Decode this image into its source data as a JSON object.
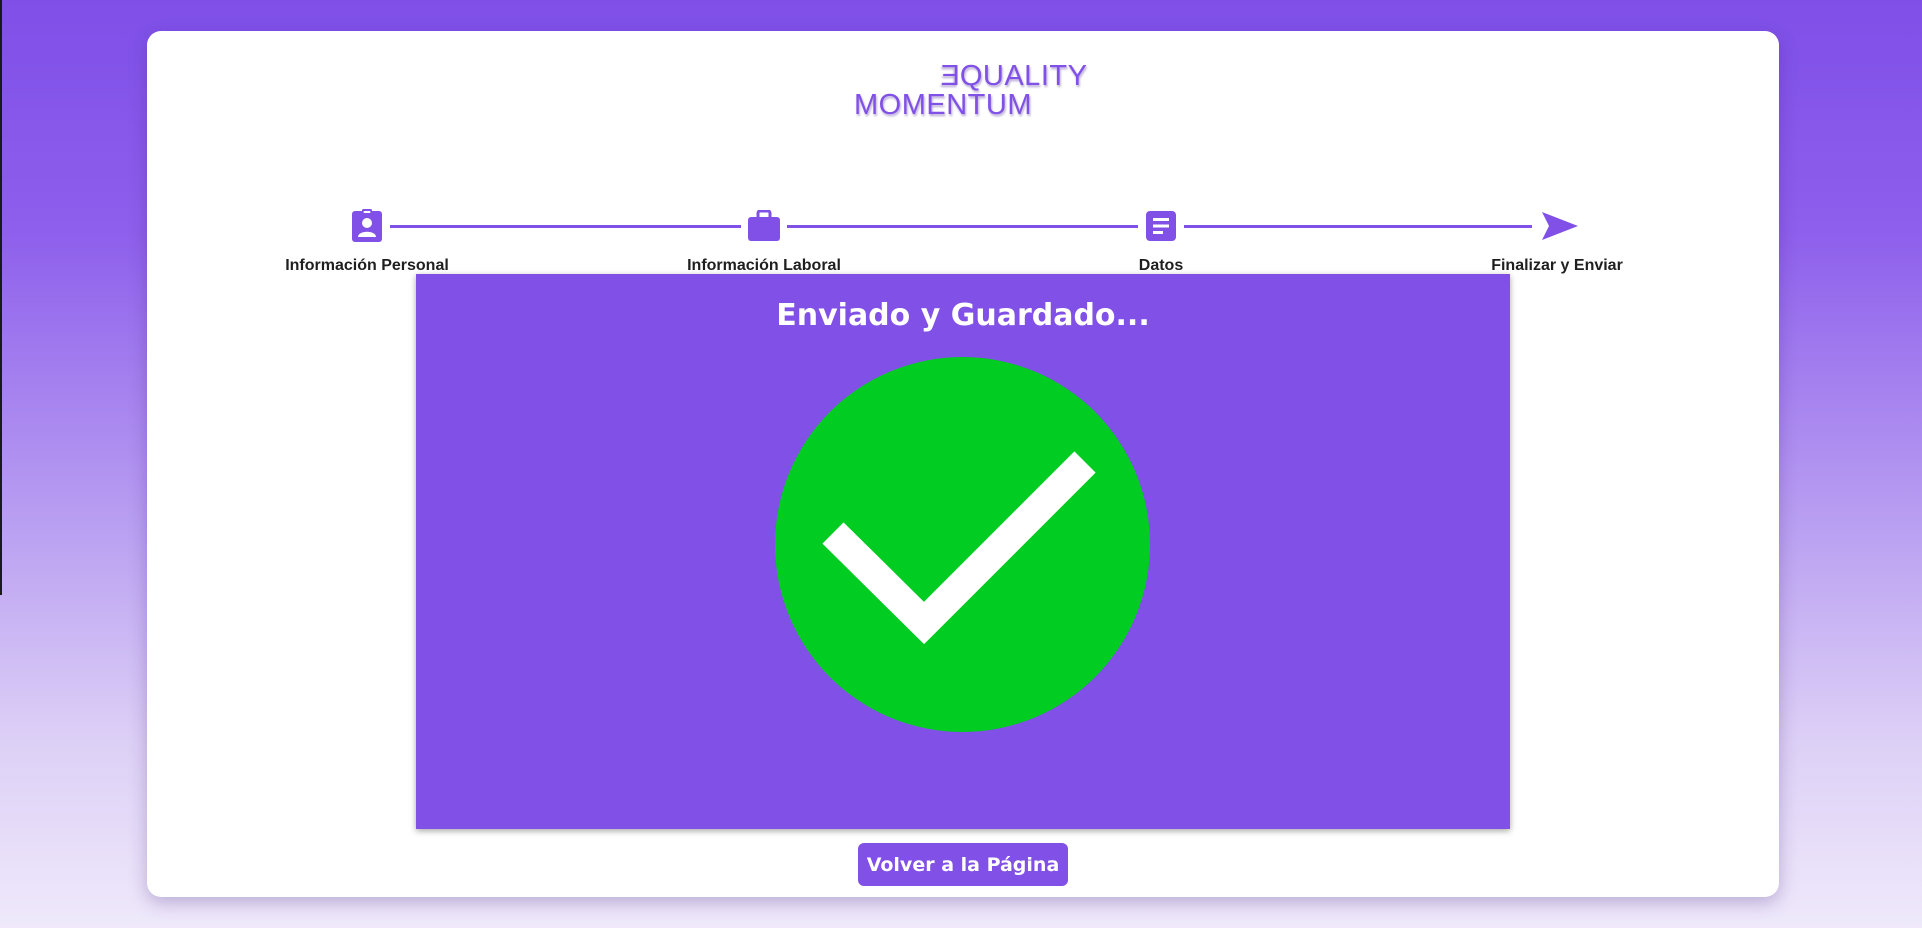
{
  "logo": {
    "line1_mirrored_letter": "E",
    "line1_rest": "QUALITY",
    "line2": "MOMENTUM"
  },
  "colors": {
    "accent": "#8150e6",
    "success": "#00cc22",
    "card": "#ffffff"
  },
  "stepper": {
    "steps": [
      {
        "label": "Información Personal",
        "icon": "id-badge-icon"
      },
      {
        "label": "Información Laboral",
        "icon": "briefcase-icon"
      },
      {
        "label": "Datos",
        "icon": "document-icon"
      },
      {
        "label": "Finalizar y Enviar",
        "icon": "send-icon"
      }
    ]
  },
  "result": {
    "title": "Enviado y Guardado...",
    "icon": "check-icon"
  },
  "actions": {
    "back_label": "Volver a la Página"
  }
}
